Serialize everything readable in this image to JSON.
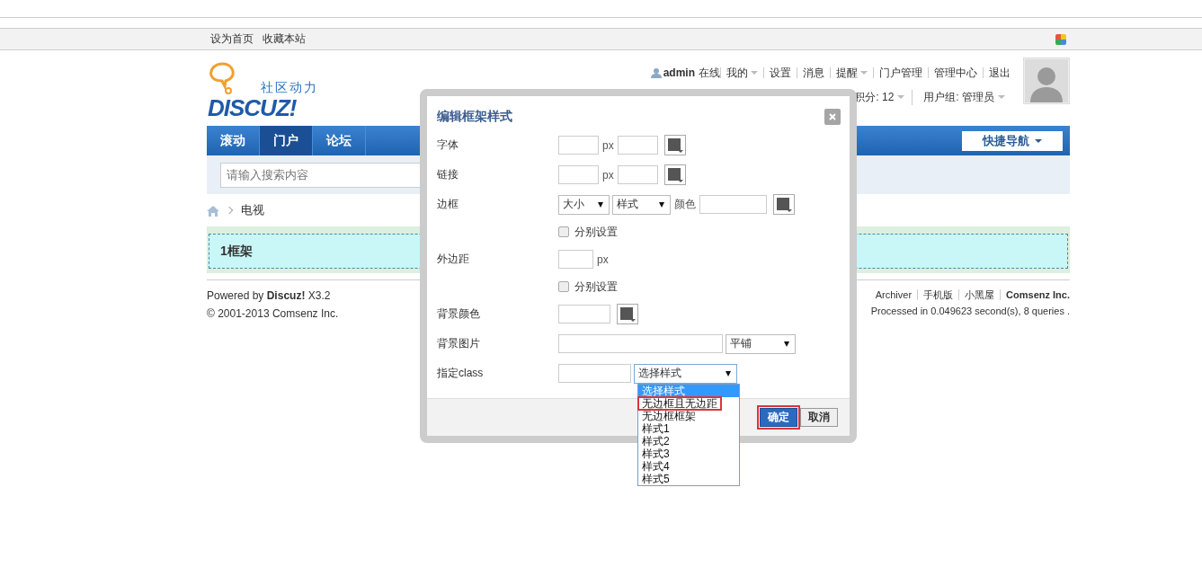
{
  "top_bar": {
    "links": [
      "设为首页",
      "收藏本站"
    ]
  },
  "header": {
    "logo": {
      "tagline": "社区动力",
      "wordmark": "DISCUZ!"
    },
    "user": {
      "name": "admin",
      "status": "在线",
      "links": [
        {
          "label": "我的",
          "has_menu": true
        },
        {
          "label": "设置",
          "has_menu": false
        },
        {
          "label": "消息",
          "has_menu": false
        },
        {
          "label": "提醒",
          "has_menu": true
        },
        {
          "label": "门户管理",
          "has_menu": false
        },
        {
          "label": "管理中心",
          "has_menu": false
        },
        {
          "label": "退出",
          "has_menu": false
        }
      ],
      "credits": "积分: 12",
      "group": "用户组: 管理员"
    }
  },
  "nav": {
    "items": [
      {
        "label": "滚动",
        "selected": false
      },
      {
        "label": "门户",
        "selected": true
      },
      {
        "label": "论坛",
        "selected": false
      }
    ],
    "quick_nav": "快捷导航"
  },
  "search": {
    "placeholder": "请输入搜索内容"
  },
  "breadcrumb": [
    "电视"
  ],
  "frame": {
    "title": "1框架"
  },
  "footer": {
    "powered": "Powered by **Discuz!** X3.2",
    "copyright": "© 2001-2013 Comsenz Inc.",
    "links": [
      "Archiver",
      "手机版",
      "小黑屋"
    ],
    "company": "Comsenz Inc.",
    "stats": "Processed in 0.049623 second(s), 8 queries ."
  },
  "dialog": {
    "title": "编辑框架样式",
    "rows": [
      {
        "kind": "size_color",
        "label": "字体",
        "unit": "px"
      },
      {
        "kind": "size_color",
        "label": "链接",
        "unit": "px"
      },
      {
        "kind": "border",
        "label": "边框",
        "size": "大小",
        "style": "样式",
        "color_label": "颜色"
      },
      {
        "kind": "checkbox",
        "label": "分别设置",
        "checked": false
      },
      {
        "kind": "margin",
        "label": "外边距",
        "unit": "px"
      },
      {
        "kind": "checkbox",
        "label": "分别设置",
        "checked": false
      },
      {
        "kind": "color",
        "label": "背景颜色"
      },
      {
        "kind": "image",
        "label": "背景图片",
        "repeat": "平铺"
      },
      {
        "kind": "class",
        "label": "指定class",
        "select": "选择样式"
      }
    ],
    "class_options": [
      {
        "label": "选择样式",
        "selected": true,
        "outlined": false
      },
      {
        "label": "无边框且无边距",
        "selected": false,
        "outlined": true
      },
      {
        "label": "无边框框架",
        "selected": false,
        "outlined": false
      },
      {
        "label": "样式1",
        "selected": false,
        "outlined": false
      },
      {
        "label": "样式2",
        "selected": false,
        "outlined": false
      },
      {
        "label": "样式3",
        "selected": false,
        "outlined": false
      },
      {
        "label": "样式4",
        "selected": false,
        "outlined": false
      },
      {
        "label": "样式5",
        "selected": false,
        "outlined": false
      }
    ],
    "buttons": [
      {
        "label": "确定",
        "kind": "primary",
        "outlined": true
      },
      {
        "label": "取消",
        "kind": "secondary",
        "outlined": false
      }
    ]
  }
}
